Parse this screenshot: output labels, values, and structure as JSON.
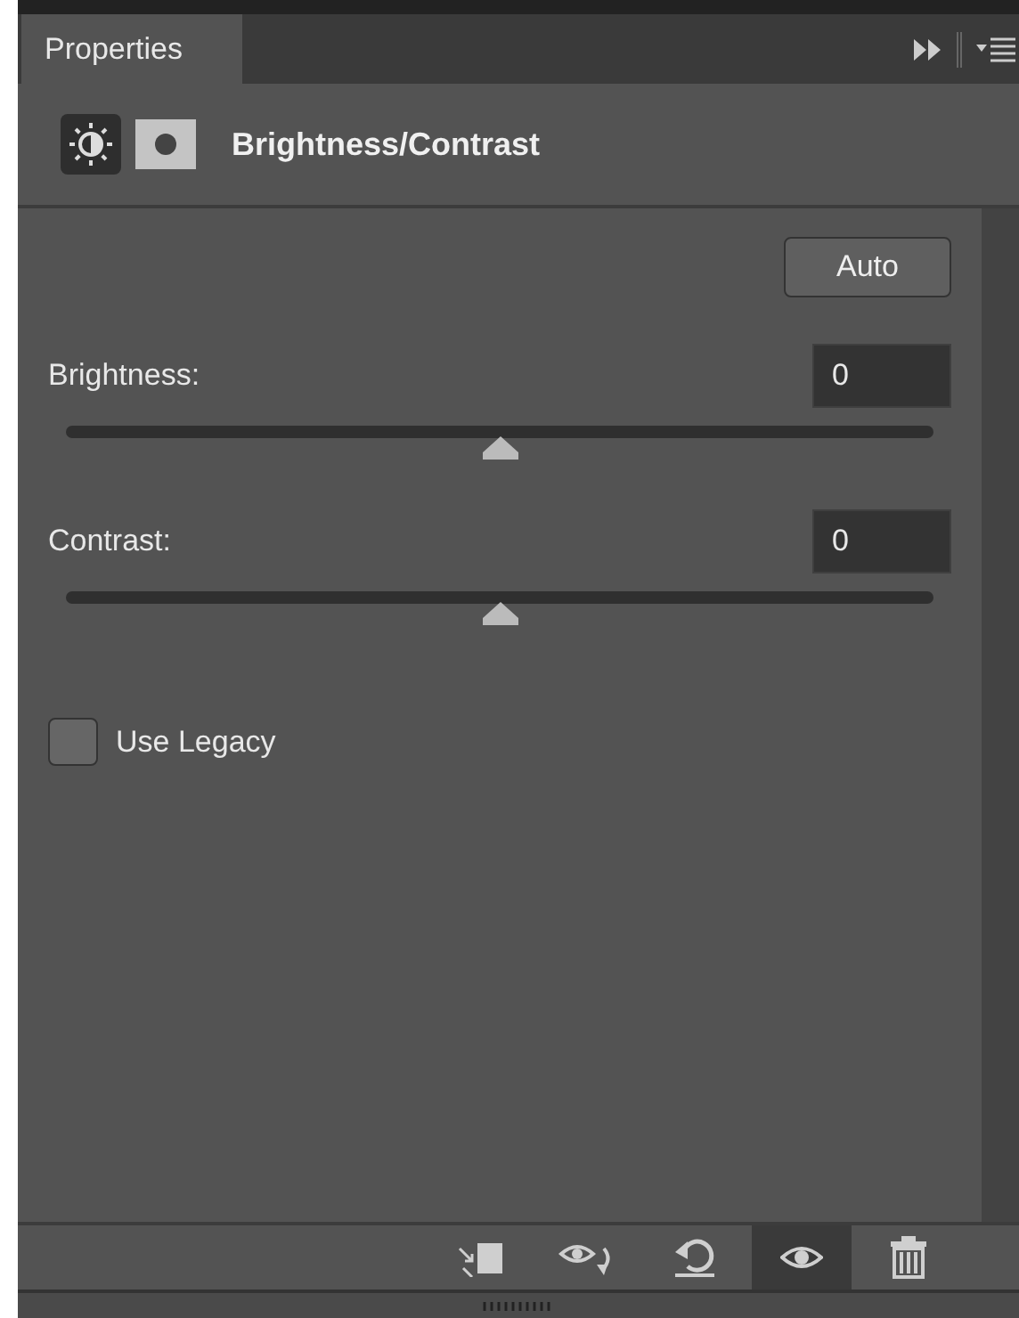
{
  "panel": {
    "tab": "Properties",
    "title": "Brightness/Contrast",
    "header_icons": [
      {
        "kind": "adjustment",
        "selected": true
      },
      {
        "kind": "mask",
        "selected": false
      }
    ]
  },
  "auto_button": "Auto",
  "sliders": [
    {
      "label": "Brightness:",
      "value": "0",
      "level": 0.5
    },
    {
      "label": "Contrast:",
      "value": "0",
      "level": 0.5
    }
  ],
  "use_legacy": {
    "label": "Use Legacy",
    "checked": false
  },
  "toolbar": [
    {
      "kind": "clip",
      "selected": false
    },
    {
      "kind": "view-previous",
      "selected": false
    },
    {
      "kind": "reset",
      "selected": false
    },
    {
      "kind": "visibility",
      "selected": true
    },
    {
      "kind": "delete",
      "selected": false
    }
  ]
}
